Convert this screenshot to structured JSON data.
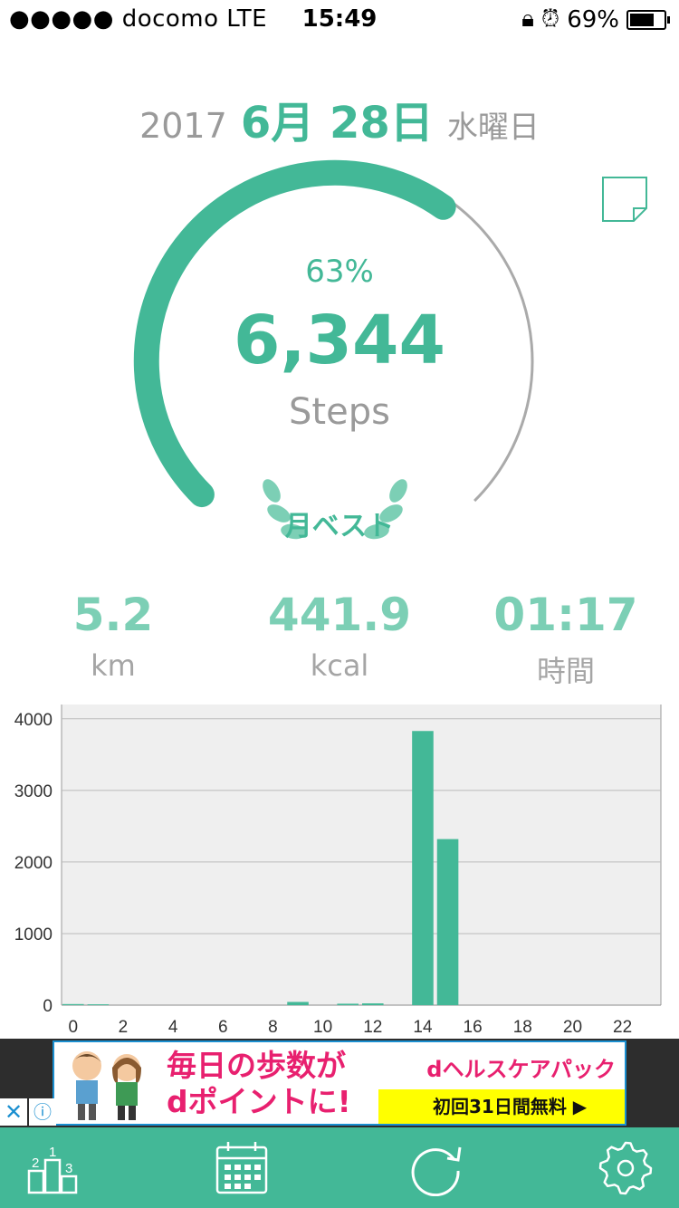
{
  "status_bar": {
    "carrier": "●●●●● docomo  LTE",
    "time": "15:49",
    "battery": "69%"
  },
  "date": {
    "year": "2017",
    "month_day": "6月 28日",
    "weekday": "水曜日"
  },
  "progress": {
    "percent_label": "63%",
    "fraction": 0.63,
    "steps": "6,344",
    "steps_label": "Steps",
    "badge": "月ベスト"
  },
  "stats": [
    {
      "value": "5.2",
      "unit": "km"
    },
    {
      "value": "441.9",
      "unit": "kcal"
    },
    {
      "value": "01:17",
      "unit": "時間"
    }
  ],
  "chart_data": {
    "type": "bar",
    "x": [
      0,
      1,
      2,
      3,
      4,
      5,
      6,
      7,
      8,
      9,
      10,
      11,
      12,
      13,
      14,
      15,
      16,
      17,
      18,
      19,
      20,
      21,
      22,
      23
    ],
    "values": [
      15,
      12,
      0,
      0,
      0,
      0,
      0,
      0,
      0,
      45,
      0,
      20,
      25,
      0,
      3830,
      2320,
      0,
      0,
      0,
      0,
      0,
      0,
      0,
      0
    ],
    "ylim": [
      0,
      4200
    ],
    "yticks": [
      "0",
      "1000",
      "2000",
      "3000",
      "4000"
    ],
    "xticks": [
      "0",
      "2",
      "4",
      "6",
      "8",
      "10",
      "12",
      "14",
      "16",
      "18",
      "20",
      "22"
    ],
    "color": "#43b897",
    "grid": true
  },
  "ad": {
    "headline": "毎日の歩数が\ndポイントに!",
    "brand": "dヘルスケアパック",
    "cta": "初回31日間無料 ▶",
    "close": "✕",
    "info": "ⓘ"
  },
  "colors": {
    "accent": "#43b897",
    "accent_light": "#7ccfb5",
    "gray": "#9a9a9a"
  },
  "tabbar": {
    "icons": [
      "ranking-icon",
      "calendar-icon",
      "refresh-icon",
      "gear-icon"
    ]
  }
}
